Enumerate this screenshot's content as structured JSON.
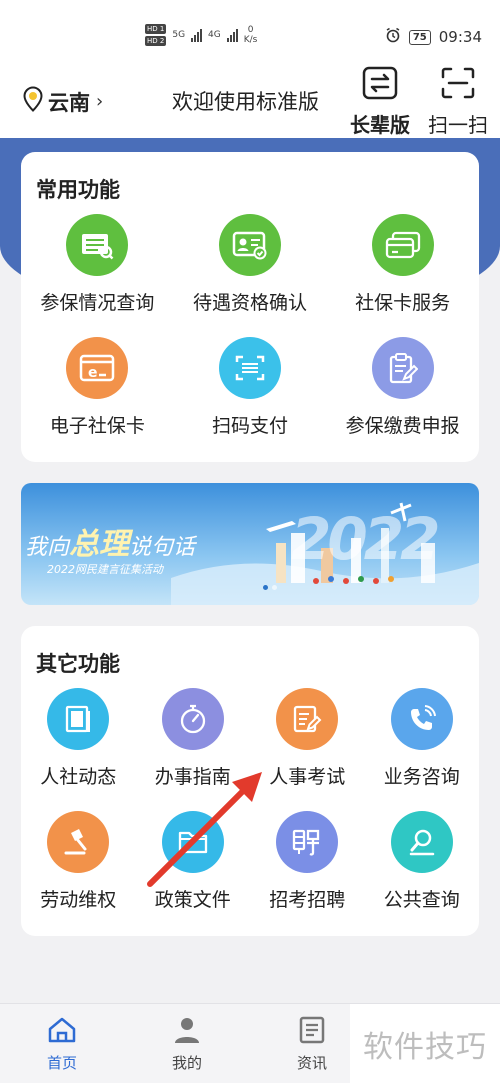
{
  "status_bar": {
    "hd1": "HD 1",
    "hd2": "HD 2",
    "net1": "5G",
    "net2": "4G",
    "speed_value": "0",
    "speed_unit": "K/s",
    "battery": "75",
    "time": "09:34"
  },
  "header": {
    "location": "云南",
    "welcome": "欢迎使用标准版",
    "elder_mode_label": "长辈版",
    "scan_label": "扫一扫"
  },
  "common_functions": {
    "title": "常用功能",
    "items": [
      {
        "label": "参保情况查询",
        "icon": "document-list-icon",
        "color": "#5fbf3f"
      },
      {
        "label": "待遇资格确认",
        "icon": "id-card-check-icon",
        "color": "#5fbf3f"
      },
      {
        "label": "社保卡服务",
        "icon": "bank-card-icon",
        "color": "#5fbf3f"
      },
      {
        "label": "电子社保卡",
        "icon": "e-card-icon",
        "color": "#f2924a"
      },
      {
        "label": "扫码支付",
        "icon": "scan-code-icon",
        "color": "#3bc1ea"
      },
      {
        "label": "参保缴费申报",
        "icon": "clipboard-edit-icon",
        "color": "#8c9be6"
      }
    ]
  },
  "banner": {
    "title_part1": "我向",
    "title_big": "总理",
    "title_part2": "说句话",
    "subtitle": "2022网民建言征集活动",
    "year": "2022"
  },
  "other_functions": {
    "title": "其它功能",
    "items": [
      {
        "label": "人社动态",
        "icon": "newspaper-icon",
        "color": "#35b9e8"
      },
      {
        "label": "办事指南",
        "icon": "compass-icon",
        "color": "#8c8fe0"
      },
      {
        "label": "人事考试",
        "icon": "exam-pen-icon",
        "color": "#f2924a"
      },
      {
        "label": "业务咨询",
        "icon": "phone-icon",
        "color": "#5aa6ec"
      },
      {
        "label": "劳动维权",
        "icon": "gavel-icon",
        "color": "#f2924a"
      },
      {
        "label": "政策文件",
        "icon": "folder-icon",
        "color": "#35b9e8"
      },
      {
        "label": "招考招聘",
        "icon": "hire-icon",
        "color": "#7b8fe6"
      },
      {
        "label": "公共查询",
        "icon": "search-person-icon",
        "color": "#2fc7c4"
      }
    ]
  },
  "bottom_nav": {
    "home": "首页",
    "mine": "我的",
    "news": "资讯"
  },
  "watermark": "软件技巧",
  "accent_color": "#4a6eb9",
  "annotation_arrow_color": "#e23a2c"
}
